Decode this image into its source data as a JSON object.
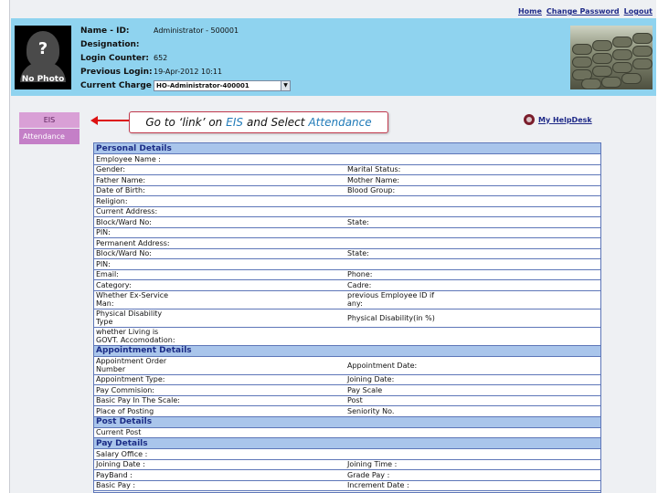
{
  "top_links": [
    "Home",
    "Change Password",
    "Logout"
  ],
  "profile": {
    "photo_symbol": "?",
    "photo_label": "No Photo",
    "fields": [
      {
        "label": "Name - ID:",
        "value": "Administrator - 500001"
      },
      {
        "label": "Designation:",
        "value": ""
      },
      {
        "label": "Login Counter:",
        "value": "652"
      },
      {
        "label": "Previous Login:",
        "value": "19-Apr-2012 10:11"
      }
    ],
    "current_charge_label": "Current Charge",
    "current_charge_value": "HO-Administrator-400001"
  },
  "menu": {
    "eis": "EIS",
    "attendance": "Attendance"
  },
  "callout": {
    "prefix": "Go to ‘link’ on",
    "link1": "EIS",
    "middle": "and Select",
    "link2": "Attendance"
  },
  "helpdesk": "My HelpDesk",
  "sections": {
    "personal": {
      "title": "Personal Details",
      "rows": [
        [
          "Employee Name :",
          ""
        ],
        [
          "Gender:",
          "Marital Status:"
        ],
        [
          "Father Name:",
          "Mother Name:"
        ],
        [
          "Date of Birth:",
          "Blood Group:"
        ],
        [
          "Religion:",
          ""
        ],
        [
          "Current Address:",
          ""
        ],
        [
          "Block/Ward No:",
          "State:"
        ],
        [
          "PIN:",
          ""
        ],
        [
          "Permanent Address:",
          ""
        ],
        [
          "Block/Ward No:",
          "State:"
        ],
        [
          "PIN:",
          ""
        ],
        [
          "Email:",
          "Phone:"
        ],
        [
          "Category:",
          "Cadre:"
        ],
        [
          "Whether Ex-Service Man:",
          "previous Employee ID if any:"
        ],
        [
          "Physical Disability Type",
          "Physical Disability(in %)"
        ],
        [
          "whether Living is GOVT. Accomodation:",
          ""
        ]
      ]
    },
    "appointment": {
      "title": "Appointment Details",
      "rows": [
        [
          "Appointment Order Number",
          "Appointment Date:"
        ],
        [
          "Appointment Type:",
          "Joining Date:"
        ],
        [
          "Pay Commision:",
          "Pay Scale"
        ],
        [
          "Basic Pay In The Scale:",
          "Post"
        ],
        [
          "Place of Posting",
          "Seniority No."
        ]
      ]
    },
    "post": {
      "title": "Post Details",
      "rows": [
        [
          "Current Post",
          ""
        ]
      ]
    },
    "pay": {
      "title": "Pay Details",
      "rows": [
        [
          "Salary Office :",
          ""
        ],
        [
          "Joining Date :",
          "Joining Time :"
        ],
        [
          "PayBand :",
          "Grade Pay :"
        ],
        [
          "Basic Pay :",
          "Increment Date :"
        ]
      ]
    }
  }
}
